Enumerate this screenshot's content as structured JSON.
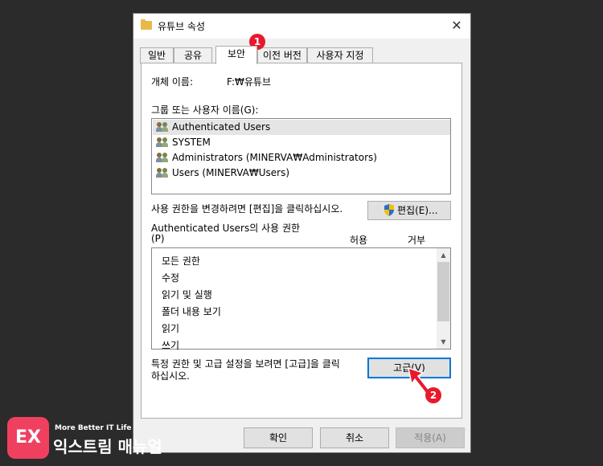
{
  "dialog": {
    "title": "유튜브 속성",
    "close_glyph": "✕"
  },
  "tabs": [
    {
      "label": "일반"
    },
    {
      "label": "공유"
    },
    {
      "label": "보안"
    },
    {
      "label": "이전 버전"
    },
    {
      "label": "사용자 지정"
    }
  ],
  "security": {
    "object_name_label": "개체 이름:",
    "object_name_value": "F:₩유튜브",
    "groups_label": "그룹 또는 사용자 이름(G):",
    "users": [
      {
        "name": "Authenticated Users"
      },
      {
        "name": "SYSTEM"
      },
      {
        "name": "Administrators (MINERVA₩Administrators)"
      },
      {
        "name": "Users (MINERVA₩Users)"
      }
    ],
    "edit_hint": "사용 권한을 변경하려면 [편집]을 클릭하십시오.",
    "edit_button": "편집(E)...",
    "perm_title_line1": "Authenticated Users의 사용 권한",
    "perm_title_line2": "(P)",
    "allow_header": "허용",
    "deny_header": "거부",
    "permissions": [
      {
        "name": "모든 권한"
      },
      {
        "name": "수정"
      },
      {
        "name": "읽기 및 실행"
      },
      {
        "name": "폴더 내용 보기"
      },
      {
        "name": "읽기"
      },
      {
        "name": "쓰기"
      }
    ],
    "advanced_hint_line1": "특정 권한 및 고급 설정을 보려면 [고급]을 클릭",
    "advanced_hint_line2": "하십시오.",
    "advanced_button": "고급(V)"
  },
  "footer": {
    "ok_button": "확인",
    "cancel_button": "취소",
    "apply_button": "적용(A)"
  },
  "annotations": {
    "badge1": "1",
    "badge2": "2",
    "badge_color": "#e8192c"
  },
  "watermark": {
    "logo_glyph": "EX",
    "tagline": "More Better IT Life",
    "name": "익스트림 매뉴얼"
  },
  "colors": {
    "selection": "#e5e5e5",
    "focus_border": "#0078d7",
    "logo_bg": "#f04060"
  }
}
